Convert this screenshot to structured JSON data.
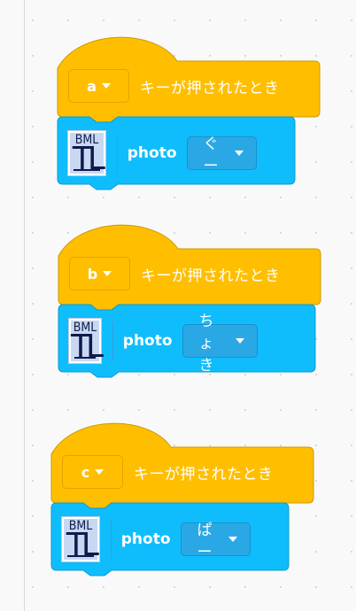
{
  "colors": {
    "event": "#ffbf00",
    "extension": "#0fbdfc"
  },
  "extension": {
    "icon_top": "BML",
    "icon_bottom": "TL",
    "icon_name": "bmltl-extension-icon"
  },
  "scripts": [
    {
      "key": "a",
      "hat_label": "キーが押されたとき",
      "command": "photo",
      "option": "ぐー"
    },
    {
      "key": "b",
      "hat_label": "キーが押されたとき",
      "command": "photo",
      "option": "ちょき"
    },
    {
      "key": "c",
      "hat_label": "キーが押されたとき",
      "command": "photo",
      "option": "ぱー"
    }
  ]
}
